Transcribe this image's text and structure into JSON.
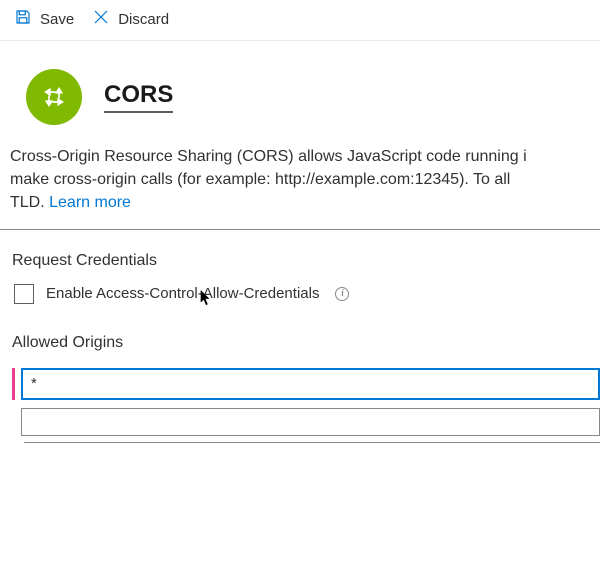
{
  "toolbar": {
    "save_label": "Save",
    "discard_label": "Discard"
  },
  "header": {
    "title": "CORS"
  },
  "description": {
    "text_part1": "Cross-Origin Resource Sharing (CORS) allows JavaScript code running i",
    "text_part2": "make cross-origin calls (for example: http://example.com:12345). To all",
    "text_part3": "TLD. ",
    "link_label": "Learn more"
  },
  "credentials": {
    "section_label": "Request Credentials",
    "checkbox_label": "Enable Access-Control-Allow-Credentials",
    "checked": false
  },
  "allowed_origins": {
    "section_label": "Allowed Origins",
    "rows": [
      {
        "value": "*"
      },
      {
        "value": ""
      }
    ]
  }
}
